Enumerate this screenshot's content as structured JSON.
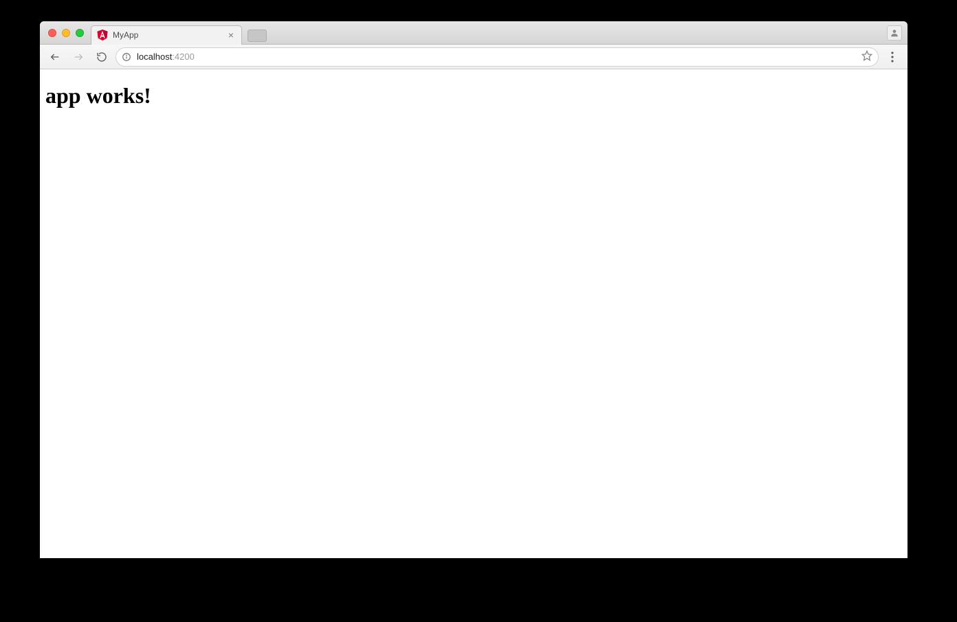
{
  "browser": {
    "tab": {
      "title": "MyApp",
      "favicon": "angular-icon"
    },
    "address": {
      "host": "localhost",
      "port": ":4200"
    }
  },
  "page": {
    "heading": "app works!"
  }
}
